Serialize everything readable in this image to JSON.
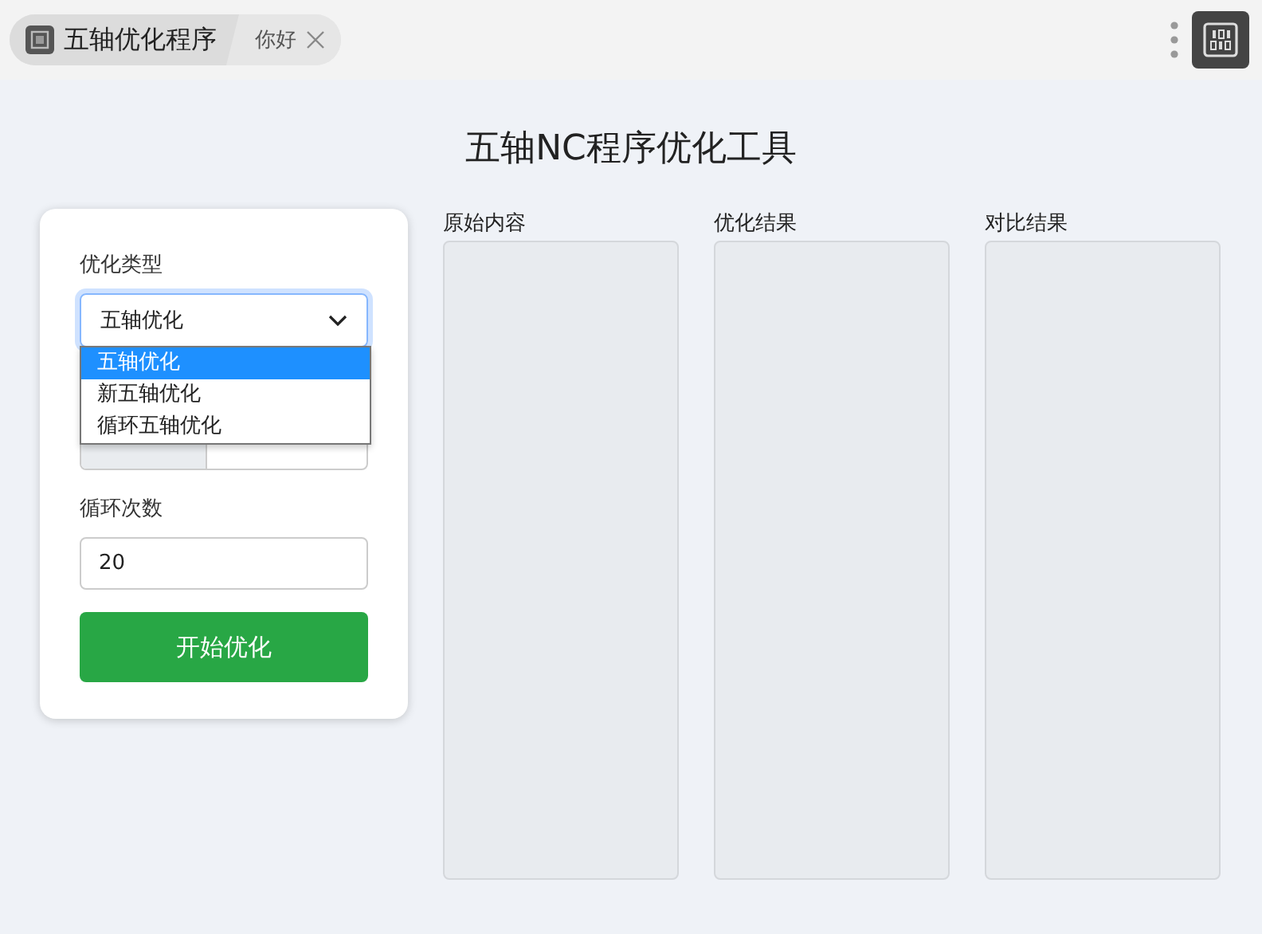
{
  "tabs": [
    {
      "label": "五轴优化程序",
      "selected": true,
      "closable": false
    },
    {
      "label": "你好",
      "selected": false,
      "closable": true
    }
  ],
  "title": "五轴NC程序优化工具",
  "form": {
    "type_label": "优化类型",
    "type_value": "五轴优化",
    "type_options": [
      {
        "label": "五轴优化",
        "selected": true
      },
      {
        "label": "新五轴优化",
        "selected": false
      },
      {
        "label": "循环五轴优化",
        "selected": false
      }
    ],
    "loop_label": "循环次数",
    "loop_value": "20",
    "start_button": "开始优化"
  },
  "panels": [
    {
      "label": "原始内容"
    },
    {
      "label": "优化结果"
    },
    {
      "label": "对比结果"
    }
  ]
}
